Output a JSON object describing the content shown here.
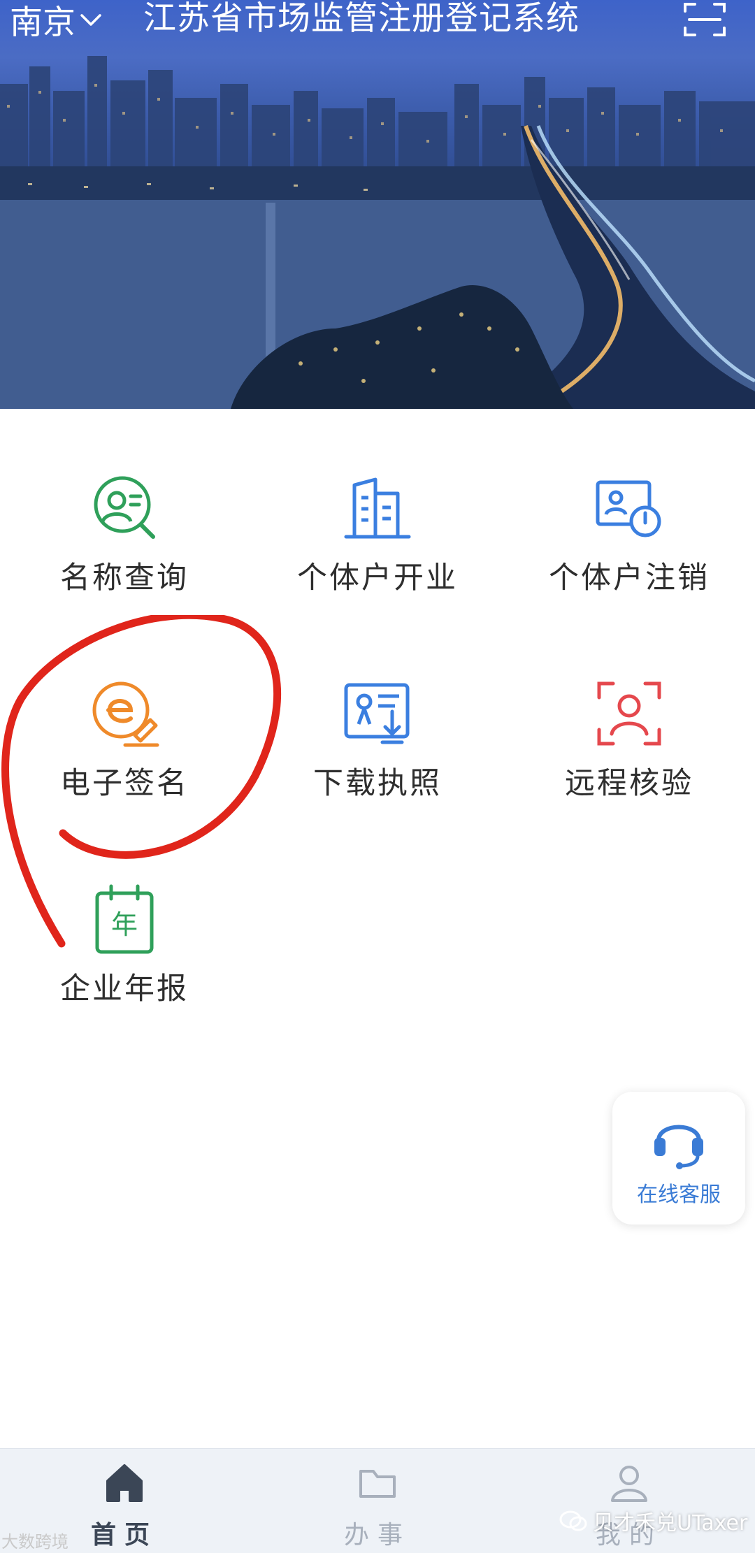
{
  "header": {
    "city": "南京",
    "title": "江苏省市场监管注册登记系统"
  },
  "services": [
    {
      "label": "名称查询",
      "icon": "name-search-icon",
      "color": "#2fa05a"
    },
    {
      "label": "个体户开业",
      "icon": "business-building-icon",
      "color": "#3b7fe0"
    },
    {
      "label": "个体户注销",
      "icon": "deregister-icon",
      "color": "#3b7fe0"
    },
    {
      "label": "电子签名",
      "icon": "e-signature-icon",
      "color": "#ef8a2a"
    },
    {
      "label": "下载执照",
      "icon": "download-license-icon",
      "color": "#3b7fe0"
    },
    {
      "label": "远程核验",
      "icon": "remote-verify-icon",
      "color": "#e5484d"
    },
    {
      "label": "企业年报",
      "icon": "annual-report-icon",
      "color": "#2fa05a"
    }
  ],
  "float_service": {
    "label": "在线客服",
    "icon": "headset-icon",
    "color": "#3a7bd5"
  },
  "tabs": [
    {
      "label": "首页",
      "icon": "home-icon",
      "active": true
    },
    {
      "label": "办事",
      "icon": "folder-icon",
      "active": false
    },
    {
      "label": "我的",
      "icon": "user-icon",
      "active": false
    }
  ],
  "watermarks": {
    "left": "大数跨境",
    "right": "贝才禾兑UTaxer"
  },
  "annotation_color": "#e0251b"
}
